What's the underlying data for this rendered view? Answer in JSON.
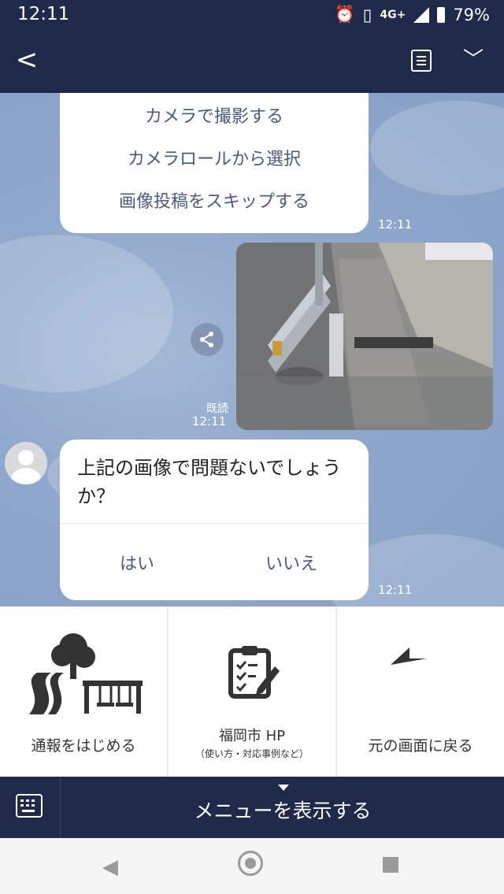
{
  "status_bar": {
    "time": "12:11",
    "network": "4G+",
    "battery": "79%"
  },
  "header": {
    "back_icon": "chevron-left-icon",
    "notes_icon": "notes-icon",
    "expand_icon": "chevron-down-icon"
  },
  "chat": {
    "option_message": {
      "options": [
        "カメラで撮影する",
        "カメラロールから選択",
        "画像投稿をスキップする"
      ],
      "time": "12:11"
    },
    "image_message": {
      "read_label": "既読",
      "time": "12:11",
      "share_icon": "share-icon"
    },
    "question_message": {
      "text": "上記の画像で問題ないでしょうか？",
      "yes_label": "はい",
      "no_label": "いいえ",
      "time": "12:11"
    }
  },
  "rich_menu": {
    "items": [
      {
        "label": "通報をはじめる",
        "icon": "park-road-icon"
      },
      {
        "label": "福岡市 HP",
        "sublabel": "（使い方・対応事例など）",
        "icon": "clipboard-icon"
      },
      {
        "label": "元の画面に戻る",
        "icon": "return-arrow-icon"
      }
    ]
  },
  "bottom_bar": {
    "menu_label": "メニューを表示する",
    "keyboard_icon": "keyboard-icon"
  },
  "colors": {
    "navy": "#1f2a4a",
    "chat_bg": "#8ba4c8"
  }
}
